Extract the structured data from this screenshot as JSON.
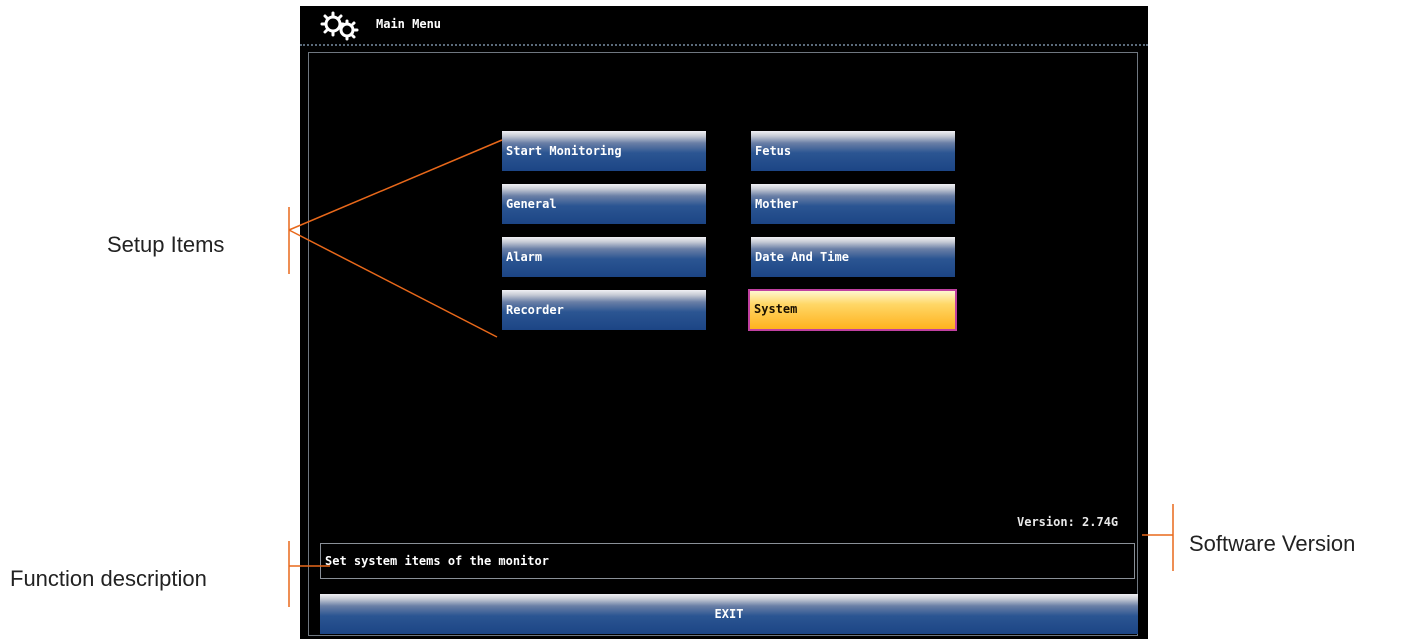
{
  "window": {
    "title": "Main Menu",
    "icon": "gears-icon"
  },
  "menu": {
    "items": [
      {
        "label": "Start Monitoring"
      },
      {
        "label": "Fetus"
      },
      {
        "label": "General"
      },
      {
        "label": "Mother"
      },
      {
        "label": "Alarm"
      },
      {
        "label": "Date And Time"
      },
      {
        "label": "Recorder"
      },
      {
        "label": "System",
        "selected": true
      }
    ]
  },
  "version_text": "Version: 2.74G",
  "description": "Set system items of the monitor",
  "exit_label": "EXIT",
  "annotations": {
    "setup_items": "Setup  Items",
    "function_description": "Function  description",
    "software_version": "Software Version"
  },
  "colors": {
    "screen_bg": "#000000",
    "button_blue": "#1c4585",
    "selected_yellow": "#ffb21e",
    "selected_border": "#c040a0",
    "annotation_line": "#e8681a"
  }
}
